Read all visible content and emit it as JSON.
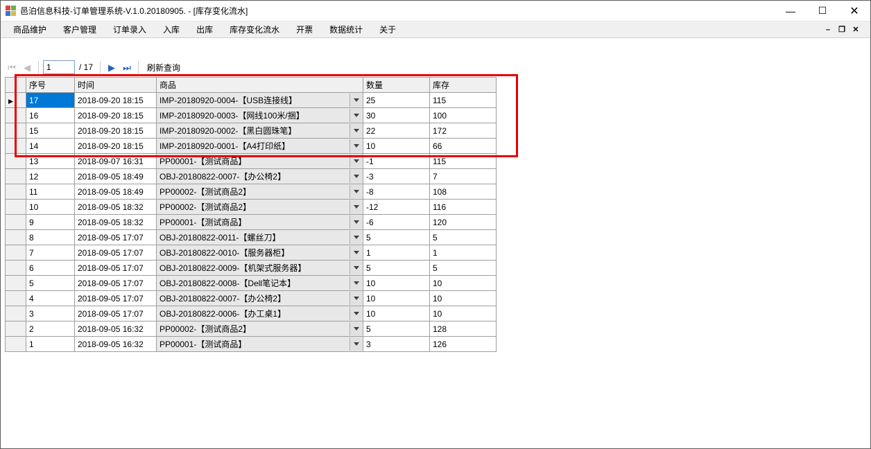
{
  "window": {
    "title": "邑泊信息科技-订单管理系统-V.1.0.20180905. - [库存变化流水]"
  },
  "menu": {
    "items": [
      "商品维护",
      "客户管理",
      "订单录入",
      "入库",
      "出库",
      "库存变化流水",
      "开票",
      "数据统计",
      "关于"
    ]
  },
  "pager": {
    "current": "1",
    "total_label": "/ 17",
    "refresh": "刷新查询"
  },
  "table": {
    "headers": {
      "seq": "序号",
      "time": "时间",
      "product": "商品",
      "qty": "数量",
      "stock": "库存"
    },
    "rows": [
      {
        "seq": "17",
        "time": "2018-09-20 18:15",
        "product": "IMP-20180920-0004-【USB连接线】",
        "qty": "25",
        "stock": "115",
        "selected": true
      },
      {
        "seq": "16",
        "time": "2018-09-20 18:15",
        "product": "IMP-20180920-0003-【网线100米/捆】",
        "qty": "30",
        "stock": "100"
      },
      {
        "seq": "15",
        "time": "2018-09-20 18:15",
        "product": "IMP-20180920-0002-【黑白圆珠笔】",
        "qty": "22",
        "stock": "172"
      },
      {
        "seq": "14",
        "time": "2018-09-20 18:15",
        "product": "IMP-20180920-0001-【A4打印纸】",
        "qty": "10",
        "stock": "66"
      },
      {
        "seq": "13",
        "time": "2018-09-07 16:31",
        "product": "PP00001-【测试商品】",
        "qty": "-1",
        "stock": "115"
      },
      {
        "seq": "12",
        "time": "2018-09-05 18:49",
        "product": "OBJ-20180822-0007-【办公椅2】",
        "qty": "-3",
        "stock": "7"
      },
      {
        "seq": "11",
        "time": "2018-09-05 18:49",
        "product": "PP00002-【测试商品2】",
        "qty": "-8",
        "stock": "108"
      },
      {
        "seq": "10",
        "time": "2018-09-05 18:32",
        "product": "PP00002-【测试商品2】",
        "qty": "-12",
        "stock": "116"
      },
      {
        "seq": "9",
        "time": "2018-09-05 18:32",
        "product": "PP00001-【测试商品】",
        "qty": "-6",
        "stock": "120"
      },
      {
        "seq": "8",
        "time": "2018-09-05 17:07",
        "product": "OBJ-20180822-0011-【螺丝刀】",
        "qty": "5",
        "stock": "5"
      },
      {
        "seq": "7",
        "time": "2018-09-05 17:07",
        "product": "OBJ-20180822-0010-【服务器柜】",
        "qty": "1",
        "stock": "1"
      },
      {
        "seq": "6",
        "time": "2018-09-05 17:07",
        "product": "OBJ-20180822-0009-【机架式服务器】",
        "qty": "5",
        "stock": "5"
      },
      {
        "seq": "5",
        "time": "2018-09-05 17:07",
        "product": "OBJ-20180822-0008-【Dell笔记本】",
        "qty": "10",
        "stock": "10"
      },
      {
        "seq": "4",
        "time": "2018-09-05 17:07",
        "product": "OBJ-20180822-0007-【办公椅2】",
        "qty": "10",
        "stock": "10"
      },
      {
        "seq": "3",
        "time": "2018-09-05 17:07",
        "product": "OBJ-20180822-0006-【办工桌1】",
        "qty": "10",
        "stock": "10"
      },
      {
        "seq": "2",
        "time": "2018-09-05 16:32",
        "product": "PP00002-【测试商品2】",
        "qty": "5",
        "stock": "128"
      },
      {
        "seq": "1",
        "time": "2018-09-05 16:32",
        "product": "PP00001-【测试商品】",
        "qty": "3",
        "stock": "126"
      }
    ]
  }
}
